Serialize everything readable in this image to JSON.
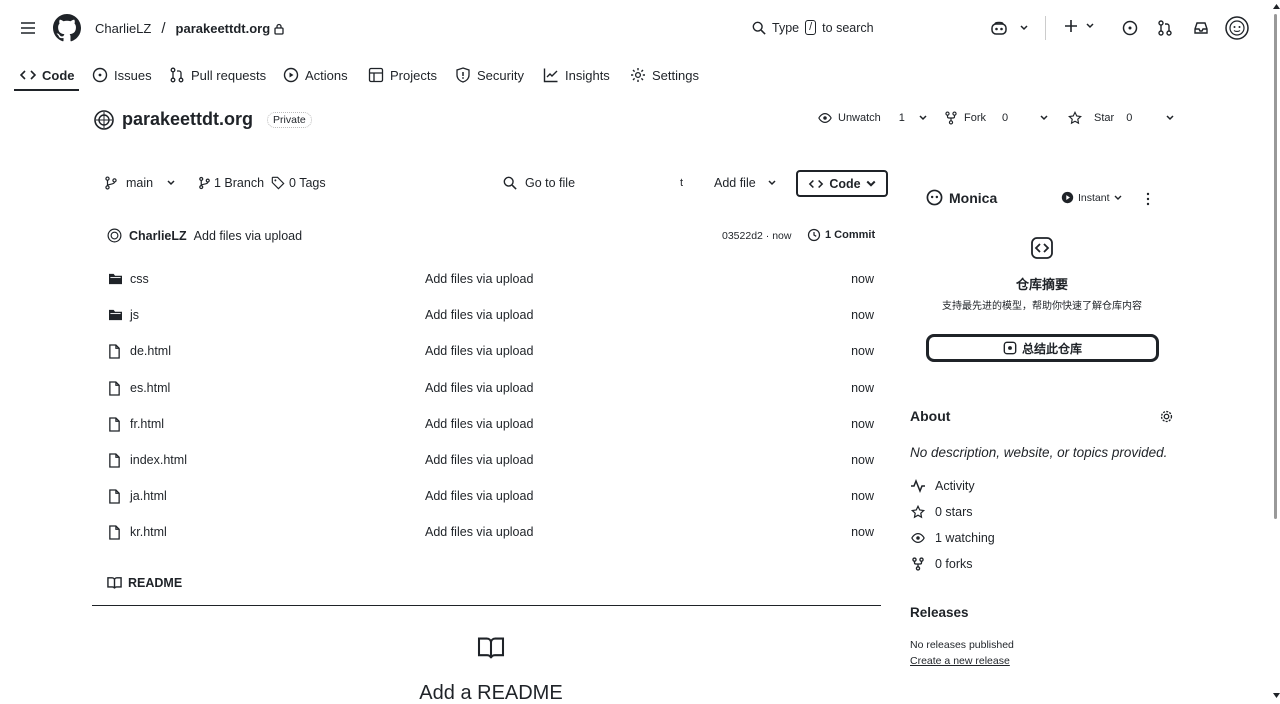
{
  "header": {
    "owner": "CharlieLZ",
    "separator": "/",
    "repo": "parakeettdt.org",
    "search_prefix": "Type",
    "search_key": "/",
    "search_suffix": "to search"
  },
  "tabs": [
    {
      "label": "Code"
    },
    {
      "label": "Issues"
    },
    {
      "label": "Pull requests"
    },
    {
      "label": "Actions"
    },
    {
      "label": "Projects"
    },
    {
      "label": "Security"
    },
    {
      "label": "Insights"
    },
    {
      "label": "Settings"
    }
  ],
  "repo": {
    "name": "parakeettdt.org",
    "visibility": "Private",
    "unwatch_label": "Unwatch",
    "unwatch_count": "1",
    "fork_label": "Fork",
    "fork_count": "0",
    "star_label": "Star",
    "star_count": "0"
  },
  "toolbar": {
    "branch": "main",
    "branches": "1 Branch",
    "tags": "0 Tags",
    "go_to_file": "Go to file",
    "shortcut": "t",
    "add_file": "Add file",
    "code_button": "Code"
  },
  "commit": {
    "author": "CharlieLZ",
    "message": "Add files via upload",
    "hash_time": "03522d2 · now",
    "commits": "1 Commit"
  },
  "files": [
    {
      "type": "folder",
      "name": "css",
      "message": "Add files via upload",
      "time": "now"
    },
    {
      "type": "folder",
      "name": "js",
      "message": "Add files via upload",
      "time": "now"
    },
    {
      "type": "file",
      "name": "de.html",
      "message": "Add files via upload",
      "time": "now"
    },
    {
      "type": "file",
      "name": "es.html",
      "message": "Add files via upload",
      "time": "now"
    },
    {
      "type": "file",
      "name": "fr.html",
      "message": "Add files via upload",
      "time": "now"
    },
    {
      "type": "file",
      "name": "index.html",
      "message": "Add files via upload",
      "time": "now"
    },
    {
      "type": "file",
      "name": "ja.html",
      "message": "Add files via upload",
      "time": "now"
    },
    {
      "type": "file",
      "name": "kr.html",
      "message": "Add files via upload",
      "time": "now"
    }
  ],
  "readme": {
    "tab_label": "README",
    "add_title": "Add a README"
  },
  "monica": {
    "name": "Monica",
    "mode": "Instant",
    "title": "仓库摘要",
    "subtitle": "支持最先进的模型，帮助你快速了解仓库内容",
    "button": "总结此仓库"
  },
  "about": {
    "title": "About",
    "description": "No description, website, or topics provided.",
    "items": [
      {
        "icon": "activity-icon",
        "label": "Activity"
      },
      {
        "icon": "star-icon",
        "label": "0 stars"
      },
      {
        "icon": "eye-icon",
        "label": "1 watching"
      },
      {
        "icon": "fork-icon",
        "label": "0 forks"
      }
    ]
  },
  "releases": {
    "title": "Releases",
    "none": "No releases published",
    "create": "Create a new release"
  }
}
